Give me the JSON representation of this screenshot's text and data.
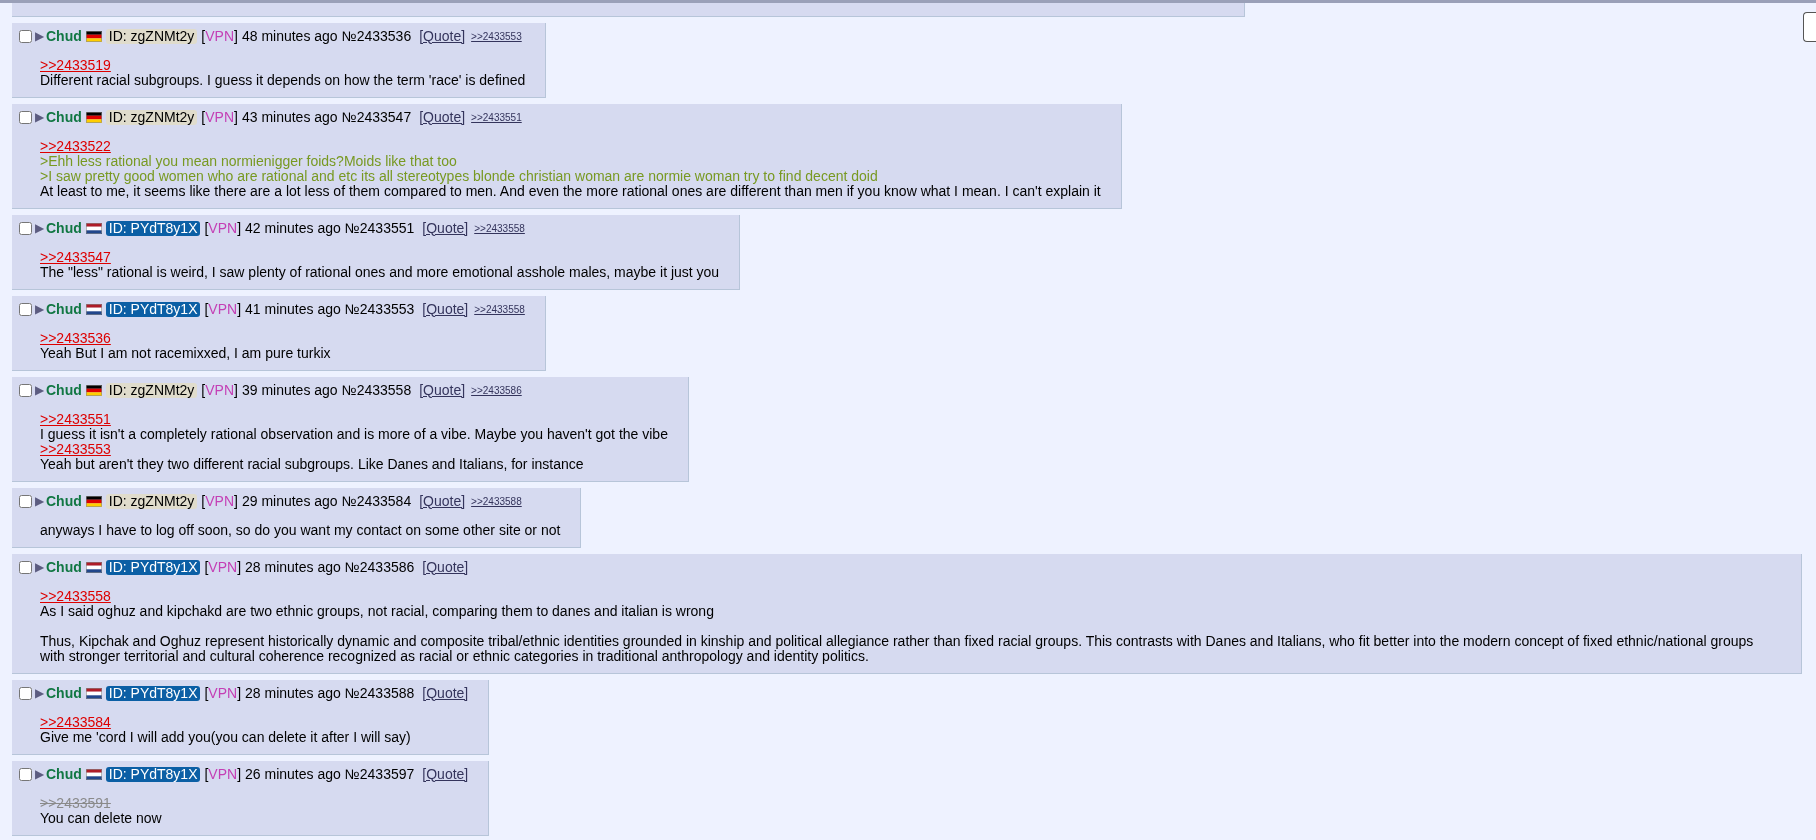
{
  "posts": [
    {
      "checked": false,
      "arrow": "▶",
      "name": "Chud",
      "flag": {
        "kind": "de"
      },
      "id": "ID: zgZNMt2y",
      "id_highlighted": false,
      "tag": "[VPN]",
      "time": "48 minutes ago",
      "number": "№2433536",
      "quote": "[Quote]",
      "backlinks": [
        ">>2433553"
      ],
      "lines": [
        {
          "kind": "reply",
          "text": ">>2433519"
        },
        {
          "kind": "text",
          "text": "Different racial subgroups. I guess it depends on how the term 'race' is defined"
        }
      ]
    },
    {
      "checked": false,
      "arrow": "▶",
      "name": "Chud",
      "flag": {
        "kind": "de"
      },
      "id": "ID: zgZNMt2y",
      "id_highlighted": false,
      "tag": "[VPN]",
      "time": "43 minutes ago",
      "number": "№2433547",
      "quote": "[Quote]",
      "backlinks": [
        ">>2433551"
      ],
      "lines": [
        {
          "kind": "reply",
          "text": ">>2433522"
        },
        {
          "kind": "greentext",
          "text": ">Ehh less rational you mean normienigger foids?Moids like that too"
        },
        {
          "kind": "greentext",
          "text": ">I saw pretty good women who are rational and etc its all stereotypes blonde christian woman are normie woman try to find decent doid"
        },
        {
          "kind": "text",
          "text": "At least to me, it seems like there are a lot less of them compared to men. And even the more rational ones are different than men if you know what I mean. I can't explain it"
        }
      ]
    },
    {
      "checked": false,
      "arrow": "▶",
      "name": "Chud",
      "flag": {
        "kind": "nl"
      },
      "id": "ID: PYdT8y1X",
      "id_highlighted": true,
      "tag": "[VPN]",
      "time": "42 minutes ago",
      "number": "№2433551",
      "quote": "[Quote]",
      "backlinks": [
        ">>2433558"
      ],
      "lines": [
        {
          "kind": "reply",
          "text": ">>2433547"
        },
        {
          "kind": "text",
          "text": "The \"less\" rational is weird, I saw plenty of rational ones and more emotional asshole males, maybe it just you"
        }
      ]
    },
    {
      "checked": false,
      "arrow": "▶",
      "name": "Chud",
      "flag": {
        "kind": "nl"
      },
      "id": "ID: PYdT8y1X",
      "id_highlighted": true,
      "tag": "[VPN]",
      "time": "41 minutes ago",
      "number": "№2433553",
      "quote": "[Quote]",
      "backlinks": [
        ">>2433558"
      ],
      "lines": [
        {
          "kind": "reply",
          "text": ">>2433536"
        },
        {
          "kind": "text",
          "text": "Yeah But I am not racemixxed, I am pure turkix"
        }
      ]
    },
    {
      "checked": false,
      "arrow": "▶",
      "name": "Chud",
      "flag": {
        "kind": "de"
      },
      "id": "ID: zgZNMt2y",
      "id_highlighted": false,
      "tag": "[VPN]",
      "time": "39 minutes ago",
      "number": "№2433558",
      "quote": "[Quote]",
      "backlinks": [
        ">>2433586"
      ],
      "lines": [
        {
          "kind": "reply",
          "text": ">>2433551"
        },
        {
          "kind": "text",
          "text": "I guess it isn't a completely rational observation and is more of a vibe. Maybe you haven't got the vibe"
        },
        {
          "kind": "reply",
          "text": ">>2433553"
        },
        {
          "kind": "text",
          "text": "Yeah but aren't they two different racial subgroups. Like Danes and Italians, for instance"
        }
      ]
    },
    {
      "checked": false,
      "arrow": "▶",
      "name": "Chud",
      "flag": {
        "kind": "de"
      },
      "id": "ID: zgZNMt2y",
      "id_highlighted": false,
      "tag": "[VPN]",
      "time": "29 minutes ago",
      "number": "№2433584",
      "quote": "[Quote]",
      "backlinks": [
        ">>2433588"
      ],
      "lines": [
        {
          "kind": "text",
          "text": "anyways I have to log off soon, so do you want my contact on some other site or not"
        }
      ]
    },
    {
      "checked": false,
      "arrow": "▶",
      "name": "Chud",
      "flag": {
        "kind": "nl"
      },
      "id": "ID: PYdT8y1X",
      "id_highlighted": true,
      "tag": "[VPN]",
      "time": "28 minutes ago",
      "number": "№2433586",
      "quote": "[Quote]",
      "lines": [
        {
          "kind": "reply",
          "text": ">>2433558"
        },
        {
          "kind": "text",
          "text": "As I said oghuz and kipchakd are two ethnic groups, not racial, comparing them to danes and italian is wrong"
        },
        {
          "kind": "blank"
        },
        {
          "kind": "text",
          "text": "Thus, Kipchak and Oghuz represent historically dynamic and composite tribal/ethnic identities grounded in kinship and political allegiance rather than fixed racial groups. This contrasts with Danes and Italians, who fit better into the modern concept of fixed ethnic/national groups with stronger territorial and cultural coherence recognized as racial or ethnic categories in traditional anthropology and identity politics."
        }
      ]
    },
    {
      "checked": false,
      "arrow": "▶",
      "name": "Chud",
      "flag": {
        "kind": "nl"
      },
      "id": "ID: PYdT8y1X",
      "id_highlighted": true,
      "tag": "[VPN]",
      "time": "28 minutes ago",
      "number": "№2433588",
      "quote": "[Quote]",
      "lines": [
        {
          "kind": "reply",
          "text": ">>2433584"
        },
        {
          "kind": "text",
          "text": "Give me 'cord I will add you(you can delete it after I will say)"
        }
      ]
    },
    {
      "checked": false,
      "arrow": "▶",
      "name": "Chud",
      "flag": {
        "kind": "nl"
      },
      "id": "ID: PYdT8y1X",
      "id_highlighted": true,
      "tag": "[VPN]",
      "time": "26 minutes ago",
      "number": "№2433597",
      "quote": "[Quote]",
      "lines": [
        {
          "kind": "dead_reply",
          "text": ">>2433591"
        },
        {
          "kind": "text",
          "text": "You can delete now"
        }
      ]
    }
  ]
}
